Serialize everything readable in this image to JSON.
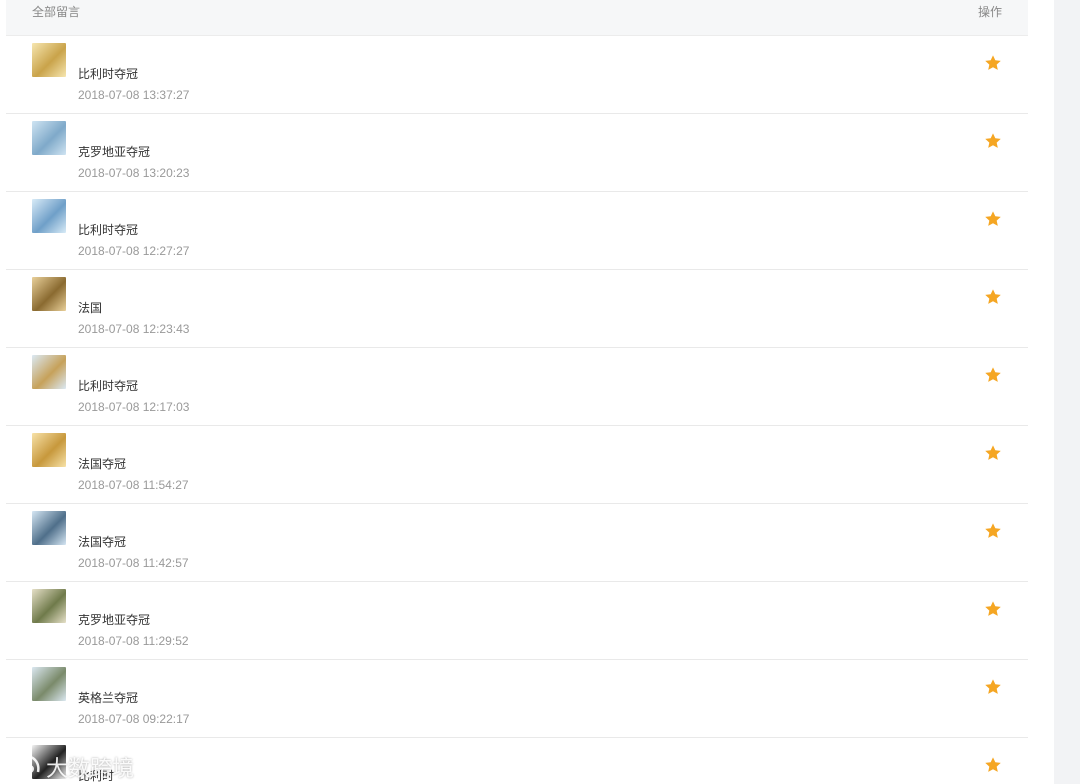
{
  "header": {
    "all_messages_label": "全部留言",
    "actions_label": "操作"
  },
  "colors": {
    "star": "#f5a623",
    "header_bg": "#f6f7f8",
    "divider": "#e9e9e9",
    "right_strip": "#f2f3f5"
  },
  "messages": [
    {
      "nickname": "",
      "text": "比利时夺冠",
      "time": "2018-07-08 13:37:27",
      "avatar_colors": [
        "#f6e6b0",
        "#c9a34a"
      ],
      "star_icon": "star-icon"
    },
    {
      "nickname": "",
      "text": "克罗地亚夺冠",
      "time": "2018-07-08 13:20:23",
      "avatar_colors": [
        "#cfe4f2",
        "#7fa9c9"
      ],
      "star_icon": "star-icon"
    },
    {
      "nickname": "",
      "text": "比利时夺冠",
      "time": "2018-07-08 12:27:27",
      "avatar_colors": [
        "#d8ebf7",
        "#6f9fc8"
      ],
      "star_icon": "star-icon"
    },
    {
      "nickname": "",
      "text": "法国",
      "time": "2018-07-08 12:23:43",
      "avatar_colors": [
        "#e9d09a",
        "#8a6a30"
      ],
      "star_icon": "star-icon"
    },
    {
      "nickname": "",
      "text": "比利时夺冠",
      "time": "2018-07-08 12:17:03",
      "avatar_colors": [
        "#dbe9f4",
        "#c6a15a"
      ],
      "star_icon": "star-icon"
    },
    {
      "nickname": "",
      "text": "法国夺冠",
      "time": "2018-07-08 11:54:27",
      "avatar_colors": [
        "#f7e2a8",
        "#c7983c"
      ],
      "star_icon": "star-icon"
    },
    {
      "nickname": "",
      "text": "法国夺冠",
      "time": "2018-07-08 11:42:57",
      "avatar_colors": [
        "#d5e6f3",
        "#4f6f8a"
      ],
      "star_icon": "star-icon"
    },
    {
      "nickname": "",
      "text": "克罗地亚夺冠",
      "time": "2018-07-08 11:29:52",
      "avatar_colors": [
        "#e6e0c8",
        "#6f7a4a"
      ],
      "star_icon": "star-icon"
    },
    {
      "nickname": "",
      "text": "英格兰夺冠",
      "time": "2018-07-08 09:22:17",
      "avatar_colors": [
        "#dbe8f1",
        "#7a8a6a"
      ],
      "star_icon": "star-icon"
    },
    {
      "nickname": "",
      "text": "比利时",
      "time": "",
      "avatar_colors": [
        "#f4f4f4",
        "#222222"
      ],
      "star_icon": "star-icon"
    }
  ],
  "watermark": {
    "text": "大数跨境"
  }
}
